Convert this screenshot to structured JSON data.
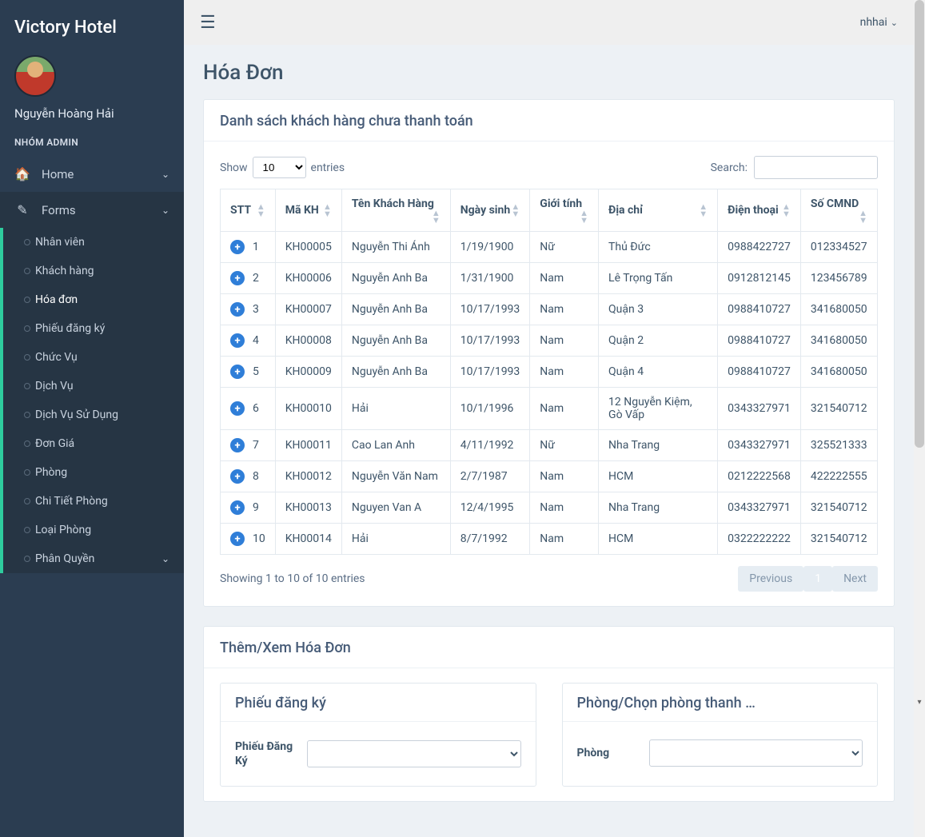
{
  "brand": "Victory Hotel",
  "profile": {
    "name": "Nguyễn Hoàng Hải",
    "role": "NHÓM ADMIN"
  },
  "nav": {
    "home": "Home",
    "forms": "Forms",
    "items": [
      {
        "label": "Nhân viên"
      },
      {
        "label": "Khách hàng"
      },
      {
        "label": "Hóa đơn"
      },
      {
        "label": "Phiếu đăng ký"
      },
      {
        "label": "Chức Vụ"
      },
      {
        "label": "Dịch Vụ"
      },
      {
        "label": "Dịch Vụ Sử Dụng"
      },
      {
        "label": "Đơn Giá"
      },
      {
        "label": "Phòng"
      },
      {
        "label": "Chi Tiết Phòng"
      },
      {
        "label": "Loại Phòng"
      },
      {
        "label": "Phân Quyền"
      }
    ]
  },
  "topbar": {
    "username": "nhhai"
  },
  "page": {
    "title": "Hóa Đơn"
  },
  "panel1": {
    "title": "Danh sách khách hàng chưa thanh toán"
  },
  "datatable": {
    "show_label": "Show",
    "entries_label": "entries",
    "length_value": "10",
    "search_label": "Search:",
    "search_value": "",
    "columns": [
      "STT",
      "Mã KH",
      "Tên Khách Hàng",
      "Ngày sinh",
      "Giới tính",
      "Địa chỉ",
      "Điện thoại",
      "Số CMND"
    ],
    "rows": [
      {
        "stt": "1",
        "ma": "KH00005",
        "ten": "Nguyễn Thi Ánh",
        "ns": "1/19/1900",
        "gt": "Nữ",
        "dc": "Thủ Đức",
        "dt": "0988422727",
        "cmnd": "012334527"
      },
      {
        "stt": "2",
        "ma": "KH00006",
        "ten": "Nguyễn Anh Ba",
        "ns": "1/31/1900",
        "gt": "Nam",
        "dc": "Lê Trọng Tấn",
        "dt": "0912812145",
        "cmnd": "123456789"
      },
      {
        "stt": "3",
        "ma": "KH00007",
        "ten": "Nguyễn Anh Ba",
        "ns": "10/17/1993",
        "gt": "Nam",
        "dc": "Quận 3",
        "dt": "0988410727",
        "cmnd": "341680050"
      },
      {
        "stt": "4",
        "ma": "KH00008",
        "ten": "Nguyễn Anh Ba",
        "ns": "10/17/1993",
        "gt": "Nam",
        "dc": "Quận 2",
        "dt": "0988410727",
        "cmnd": "341680050"
      },
      {
        "stt": "5",
        "ma": "KH00009",
        "ten": "Nguyễn Anh Ba",
        "ns": "10/17/1993",
        "gt": "Nam",
        "dc": "Quận 4",
        "dt": "0988410727",
        "cmnd": "341680050"
      },
      {
        "stt": "6",
        "ma": "KH00010",
        "ten": "Hải",
        "ns": "10/1/1996",
        "gt": "Nam",
        "dc": "12 Nguyễn Kiệm, Gò Vấp",
        "dt": "0343327971",
        "cmnd": "321540712"
      },
      {
        "stt": "7",
        "ma": "KH00011",
        "ten": "Cao Lan Anh",
        "ns": "4/11/1992",
        "gt": "Nữ",
        "dc": "Nha Trang",
        "dt": "0343327971",
        "cmnd": "325521333"
      },
      {
        "stt": "8",
        "ma": "KH00012",
        "ten": "Nguyễn Văn Nam",
        "ns": "2/7/1987",
        "gt": "Nam",
        "dc": "HCM",
        "dt": "0212222568",
        "cmnd": "422222555"
      },
      {
        "stt": "9",
        "ma": "KH00013",
        "ten": "Nguyen Van A",
        "ns": "12/4/1995",
        "gt": "Nam",
        "dc": "Nha Trang",
        "dt": "0343327971",
        "cmnd": "321540712"
      },
      {
        "stt": "10",
        "ma": "KH00014",
        "ten": "Hải",
        "ns": "8/7/1992",
        "gt": "Nam",
        "dc": "HCM",
        "dt": "0322222222",
        "cmnd": "321540712"
      }
    ],
    "info": "Showing 1 to 10 of 10 entries",
    "pager": {
      "prev": "Previous",
      "next": "Next",
      "page": "1"
    }
  },
  "panel2": {
    "title": "Thêm/Xem Hóa Đơn"
  },
  "form_cards": {
    "left": {
      "title": "Phiếu đăng ký",
      "label": "Phiếu Đăng Ký"
    },
    "right": {
      "title": "Phòng/Chọn phòng thanh …",
      "label": "Phòng"
    }
  }
}
